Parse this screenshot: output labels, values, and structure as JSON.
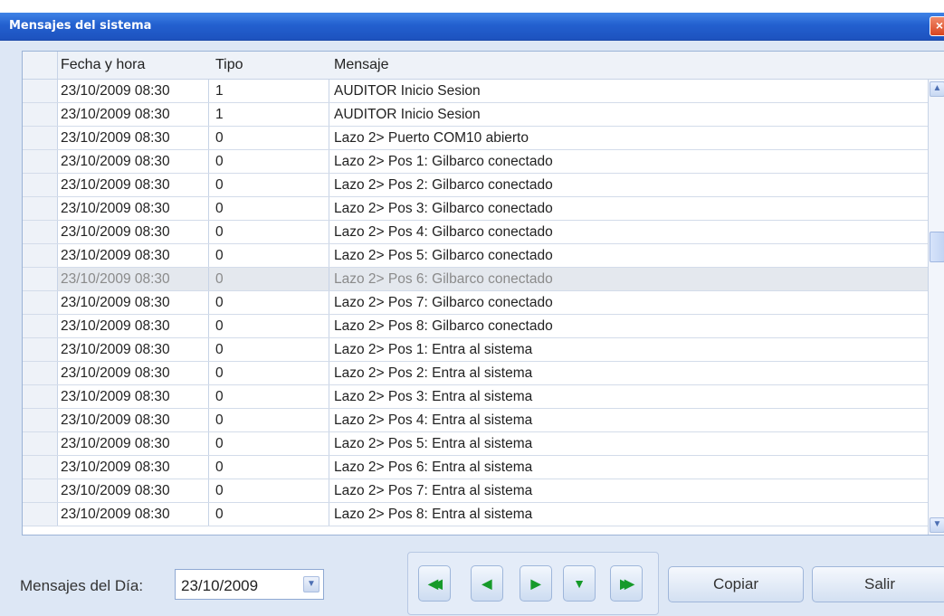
{
  "window": {
    "title": "Mensajes del sistema",
    "close_glyph": "×"
  },
  "table": {
    "columns": [
      "Fecha y hora",
      "Tipo",
      "Mensaje"
    ],
    "rows": [
      {
        "fecha": "23/10/2009 08:30",
        "tipo": "1",
        "mensaje": "AUDITOR Inicio Sesion"
      },
      {
        "fecha": "23/10/2009 08:30",
        "tipo": "1",
        "mensaje": "AUDITOR Inicio Sesion"
      },
      {
        "fecha": "23/10/2009 08:30",
        "tipo": "0",
        "mensaje": "Lazo 2> Puerto COM10 abierto"
      },
      {
        "fecha": "23/10/2009 08:30",
        "tipo": "0",
        "mensaje": "Lazo 2> Pos 1: Gilbarco conectado"
      },
      {
        "fecha": "23/10/2009 08:30",
        "tipo": "0",
        "mensaje": "Lazo 2> Pos 2: Gilbarco conectado"
      },
      {
        "fecha": "23/10/2009 08:30",
        "tipo": "0",
        "mensaje": "Lazo 2> Pos 3: Gilbarco conectado"
      },
      {
        "fecha": "23/10/2009 08:30",
        "tipo": "0",
        "mensaje": "Lazo 2> Pos 4: Gilbarco conectado"
      },
      {
        "fecha": "23/10/2009 08:30",
        "tipo": "0",
        "mensaje": "Lazo 2> Pos 5: Gilbarco conectado"
      },
      {
        "fecha": "23/10/2009 08:30",
        "tipo": "0",
        "mensaje": "Lazo 2> Pos 6: Gilbarco conectado"
      },
      {
        "fecha": "23/10/2009 08:30",
        "tipo": "0",
        "mensaje": "Lazo 2> Pos 7: Gilbarco conectado"
      },
      {
        "fecha": "23/10/2009 08:30",
        "tipo": "0",
        "mensaje": "Lazo 2> Pos 8: Gilbarco conectado"
      },
      {
        "fecha": "23/10/2009 08:30",
        "tipo": "0",
        "mensaje": "Lazo 2> Pos 1:  Entra al sistema"
      },
      {
        "fecha": "23/10/2009 08:30",
        "tipo": "0",
        "mensaje": "Lazo 2> Pos 2:  Entra al sistema"
      },
      {
        "fecha": "23/10/2009 08:30",
        "tipo": "0",
        "mensaje": "Lazo 2> Pos 3:  Entra al sistema"
      },
      {
        "fecha": "23/10/2009 08:30",
        "tipo": "0",
        "mensaje": "Lazo 2> Pos 4:  Entra al sistema"
      },
      {
        "fecha": "23/10/2009 08:30",
        "tipo": "0",
        "mensaje": "Lazo 2> Pos 5:  Entra al sistema"
      },
      {
        "fecha": "23/10/2009 08:30",
        "tipo": "0",
        "mensaje": "Lazo 2> Pos 6:  Entra al sistema"
      },
      {
        "fecha": "23/10/2009 08:30",
        "tipo": "0",
        "mensaje": "Lazo 2> Pos 7:  Entra al sistema"
      },
      {
        "fecha": "23/10/2009 08:30",
        "tipo": "0",
        "mensaje": "Lazo 2> Pos 8:  Entra al sistema"
      }
    ],
    "hover_row_index": 8
  },
  "footer": {
    "day_label": "Mensajes del Día:",
    "date_value": "23/10/2009",
    "nav_buttons": [
      {
        "name": "first-page-button",
        "icon": "double-left-icon",
        "glyph": "◀◀"
      },
      {
        "name": "previous-page-button",
        "icon": "left-arrow-icon",
        "glyph": "◀"
      },
      {
        "name": "next-page-button",
        "icon": "right-arrow-icon",
        "glyph": "▶"
      },
      {
        "name": "down-button",
        "icon": "down-arrow-icon",
        "glyph": "▼"
      },
      {
        "name": "last-page-button",
        "icon": "double-right-icon",
        "glyph": "▶▶"
      }
    ],
    "copy_label": "Copiar",
    "exit_label": "Salir"
  },
  "colors": {
    "titlebar": "#2360cf",
    "nav_icon": "#169a2a",
    "window_bg": "#dde7f5"
  }
}
